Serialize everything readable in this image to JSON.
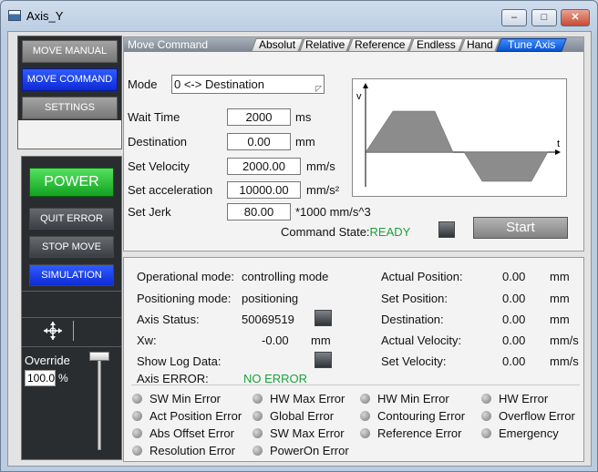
{
  "window": {
    "title": "Axis_Y",
    "minimize": "–",
    "maximize": "□",
    "close": "✕"
  },
  "nav": {
    "move_manual": "MOVE MANUAL",
    "move_command": "MOVE COMMAND",
    "settings": "SETTINGS"
  },
  "control": {
    "power": "POWER",
    "quit_error": "QUIT ERROR",
    "stop_move": "STOP MOVE",
    "simulation": "SIMULATION",
    "move_icon": "move-cross-icon",
    "override_label": "Override",
    "override_value": "100.0",
    "override_unit": "%",
    "override_level": 1.0
  },
  "command": {
    "title": "Move Command",
    "tabs": [
      "Absolut",
      "Relative",
      "Reference",
      "Endless",
      "Hand",
      "Tune Axis"
    ],
    "active_tab": "Tune Axis",
    "mode_label": "Mode",
    "mode_value": "0 <-> Destination",
    "rows": [
      {
        "label": "Wait Time",
        "value": "2000",
        "unit": "ms"
      },
      {
        "label": "Destination",
        "value": "0.00",
        "unit": "mm"
      },
      {
        "label": "Set Velocity",
        "value": "2000.00",
        "unit": "mm/s"
      },
      {
        "label": "Set acceleration",
        "value": "10000.00",
        "unit": "mm/s²"
      },
      {
        "label": "Set Jerk",
        "value": "80.00",
        "unit": "*1000 mm/s^3"
      }
    ],
    "graph": {
      "y_label": "v",
      "x_label": "t"
    },
    "state_label": "Command State:",
    "state_value": "READY",
    "start": "Start",
    "colors": {
      "ready": "#1aa33a",
      "active_tab": "#1f6ee8"
    }
  },
  "status": {
    "left": [
      {
        "label": "Operational mode:",
        "value": "controlling mode"
      },
      {
        "label": "Positioning mode:",
        "value": "positioning"
      },
      {
        "label": "Axis Status:",
        "value": "50069519"
      },
      {
        "label": "Xw:",
        "value": "-0.00",
        "unit": "mm"
      },
      {
        "label": "Show Log Data:"
      },
      {
        "label": "Axis ERROR:",
        "value": "NO ERROR"
      }
    ],
    "right": [
      {
        "label": "Actual Position:",
        "value": "0.00",
        "unit": "mm"
      },
      {
        "label": "Set Position:",
        "value": "0.00",
        "unit": "mm"
      },
      {
        "label": "Destination:",
        "value": "0.00",
        "unit": "mm"
      },
      {
        "label": "Actual Velocity:",
        "value": "0.00",
        "unit": "mm/s"
      },
      {
        "label": "Set Velocity:",
        "value": "0.00",
        "unit": "mm/s"
      }
    ],
    "errors": [
      "SW Min Error",
      "HW Max Error",
      "HW Min Error",
      "HW Error",
      "Act Position Error",
      "Global Error",
      "Contouring Error",
      "Overflow Error",
      "Abs Offset Error",
      "SW Max Error",
      "Reference Error",
      "Emergency",
      "Resolution Error",
      "PowerOn Error"
    ]
  }
}
